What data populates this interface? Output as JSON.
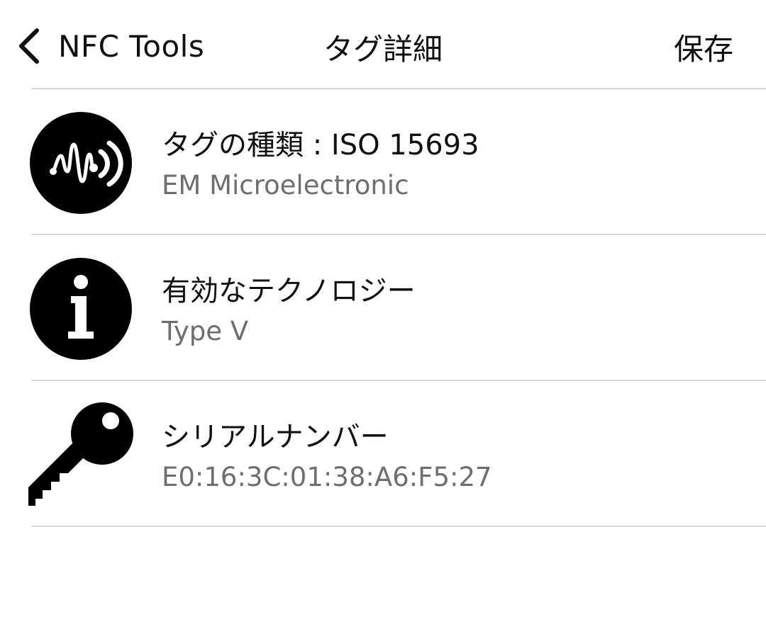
{
  "navbar": {
    "back_label": "NFC Tools",
    "title": "タグ詳細",
    "save_label": "保存"
  },
  "rows": [
    {
      "icon": "nfc-signal-icon",
      "title": "タグの種類 : ISO 15693",
      "subtitle": "EM Microelectronic"
    },
    {
      "icon": "info-icon",
      "title": "有効なテクノロジー",
      "subtitle": "Type V"
    },
    {
      "icon": "key-icon",
      "title": "シリアルナンバー",
      "subtitle": "E0:16:3C:01:38:A6:F5:27"
    }
  ],
  "colors": {
    "text": "#111111",
    "secondary_text": "#6e6e6e",
    "divider": "#d9d9d9",
    "background": "#ffffff"
  }
}
